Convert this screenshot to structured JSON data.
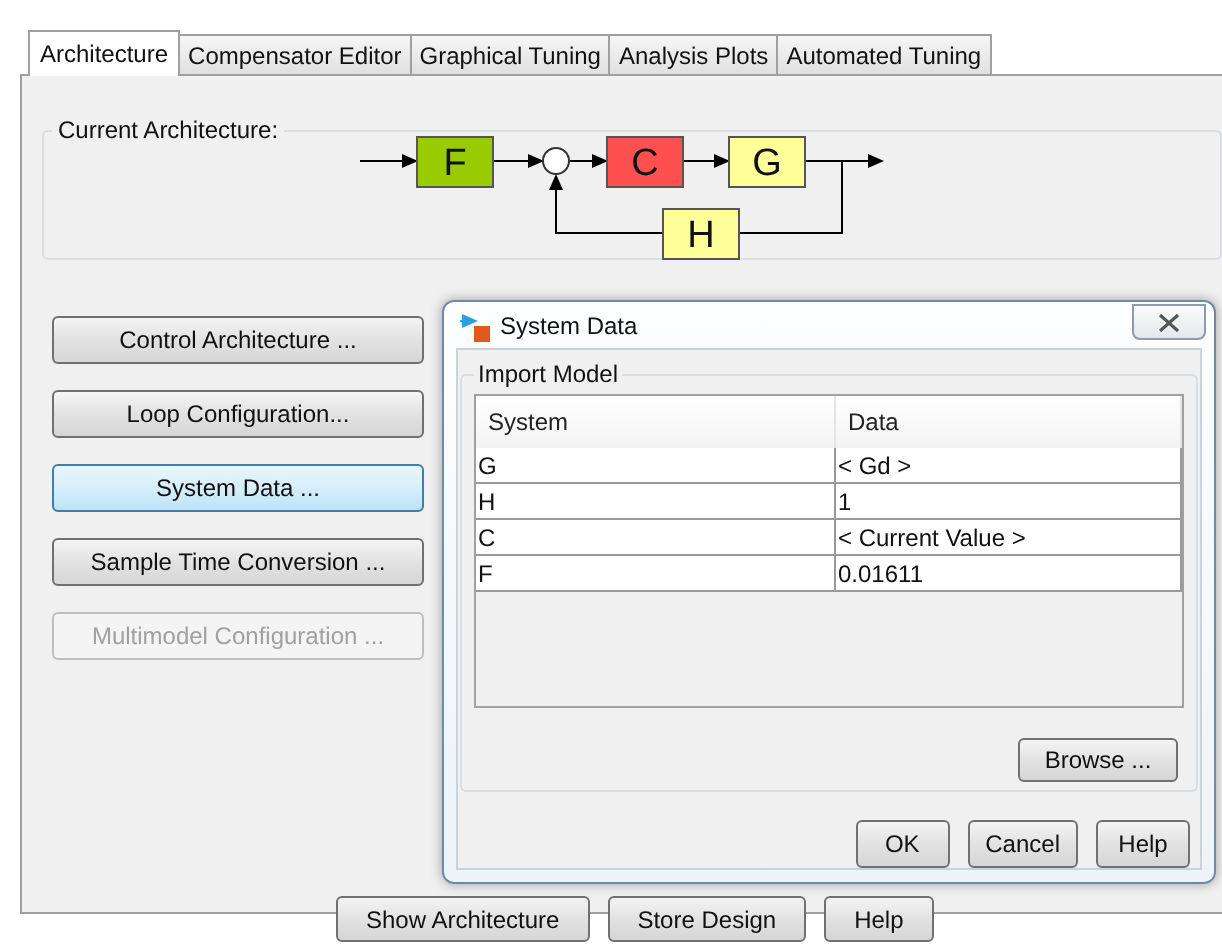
{
  "tabs": [
    {
      "label": "Architecture",
      "selected": true
    },
    {
      "label": "Compensator Editor",
      "selected": false
    },
    {
      "label": "Graphical Tuning",
      "selected": false
    },
    {
      "label": "Analysis Plots",
      "selected": false
    },
    {
      "label": "Automated Tuning",
      "selected": false
    }
  ],
  "architecture": {
    "title": "Current Architecture:",
    "blocks": [
      {
        "label": "F",
        "color": "#99cc00"
      },
      {
        "label": "C",
        "color": "#ff4f4f"
      },
      {
        "label": "G",
        "color": "#ffff99"
      },
      {
        "label": "H",
        "color": "#ffff99"
      }
    ]
  },
  "actions": [
    {
      "label": "Control Architecture ...",
      "selected": false,
      "disabled": false
    },
    {
      "label": "Loop Configuration...",
      "selected": false,
      "disabled": false
    },
    {
      "label": "System Data ...",
      "selected": true,
      "disabled": false
    },
    {
      "label": "Sample Time Conversion ...",
      "selected": false,
      "disabled": false
    },
    {
      "label": "Multimodel Configuration ...",
      "selected": false,
      "disabled": true
    }
  ],
  "dialog": {
    "title": "System Data",
    "group": "Import Model",
    "columns": [
      "System",
      "Data"
    ],
    "rows": [
      [
        "G",
        "< Gd >"
      ],
      [
        "H",
        "1"
      ],
      [
        "C",
        "< Current Value >"
      ],
      [
        "F",
        "0.01611"
      ]
    ],
    "browse": "Browse ...",
    "buttons": [
      "OK",
      "Cancel",
      "Help"
    ]
  },
  "footer_buttons": [
    "Show Architecture",
    "Store Design",
    "Help"
  ]
}
